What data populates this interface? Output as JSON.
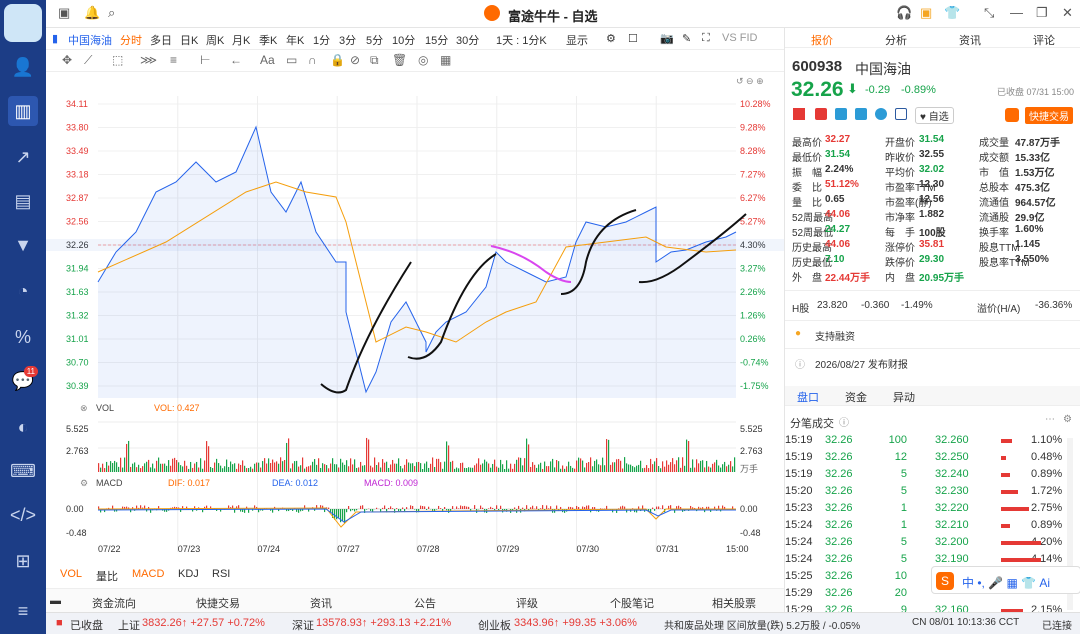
{
  "app": {
    "title": "富途牛牛 - 自选"
  },
  "sidebar": {
    "chat_badge": "11"
  },
  "toolbar": {
    "stock": "中国海油",
    "periods": [
      "分时",
      "多日",
      "日K",
      "周K",
      "月K",
      "季K",
      "年K",
      "1分",
      "3分",
      "5分",
      "10分",
      "15分",
      "30分"
    ],
    "active_period": "分时",
    "range": "1天 : 1分K",
    "display": "显示",
    "vs": "VS FID"
  },
  "chart_labels": {
    "vol": "VOL",
    "vol_value": "VOL: 0.427",
    "vol_unit": "万手",
    "macd": "MACD",
    "dif": "DIF: 0.017",
    "dea": "DEA: 0.012",
    "macd_value": "MACD: 0.009"
  },
  "chart_data": {
    "type": "line",
    "y_left": [
      "34.11",
      "33.80",
      "33.49",
      "33.18",
      "32.87",
      "32.56",
      "32.26",
      "31.94",
      "31.63",
      "31.32",
      "31.01",
      "30.70",
      "30.39"
    ],
    "y_right": [
      "10.28%",
      "9.28%",
      "8.28%",
      "7.27%",
      "6.27%",
      "5.27%",
      "4.30%",
      "3.27%",
      "2.26%",
      "1.26%",
      "0.26%",
      "-0.74%",
      "-1.75%"
    ],
    "vol_axis": [
      "5.525",
      "2.763"
    ],
    "macd_axis": [
      "0.00",
      "-0.48"
    ],
    "x": [
      "07/22",
      "07/23",
      "07/24",
      "07/27",
      "07/28",
      "07/29",
      "07/30",
      "07/31",
      "15:00"
    ]
  },
  "bottom_tabs": [
    "VOL",
    "量比",
    "MACD",
    "KDJ",
    "RSI"
  ],
  "info_tabs": [
    "资金流向",
    "快捷交易",
    "资讯",
    "公告",
    "评级",
    "个股笔记",
    "相关股票"
  ],
  "right": {
    "tabs": [
      "报价",
      "分析",
      "资讯",
      "评论"
    ],
    "code": "600938",
    "name": "中国海油",
    "price": "32.26",
    "change": "-0.29",
    "pct": "-0.89%",
    "status": "已收盘 07/31 15:00",
    "watch": "自选",
    "trade": "快捷交易",
    "stats": [
      [
        "最高价",
        "32.27",
        "开盘价",
        "31.54",
        "成交量",
        "47.87万手"
      ],
      [
        "最低价",
        "31.54",
        "昨收价",
        "32.55",
        "成交额",
        "15.33亿"
      ],
      [
        "振　幅",
        "2.24%",
        "平均价",
        "32.02",
        "市　值",
        "1.53万亿"
      ],
      [
        "委　比",
        "51.12%",
        "市盈率TTM",
        "12.30",
        "总股本",
        "475.3亿"
      ],
      [
        "量　比",
        "0.65",
        "市盈率(静)",
        "12.56",
        "流通值",
        "964.57亿"
      ],
      [
        "52周最高",
        "44.06",
        "市净率",
        "1.882",
        "流通股",
        "29.9亿"
      ],
      [
        "52周最低",
        "24.27",
        "每　手",
        "100股",
        "换手率",
        "1.60%"
      ],
      [
        "历史最高",
        "44.06",
        "涨停价",
        "35.81",
        "股息TTM",
        "1.145"
      ],
      [
        "历史最低",
        "7.10",
        "跌停价",
        "29.30",
        "股息率TTM",
        "3.550%"
      ],
      [
        "外　盘",
        "22.44万手",
        "内　盘",
        "20.95万手",
        "",
        ""
      ]
    ],
    "h_label": "H股",
    "h_price": "23.820",
    "h_change": "-0.360",
    "h_pct": "-1.49%",
    "premium_label": "溢价(H/A)",
    "premium": "-36.36%",
    "margin": "支持融资",
    "report": "2026/08/27  发布财报",
    "sub_tabs": [
      "盘口",
      "资金",
      "异动"
    ],
    "ticks_title": "分笔成交",
    "ticks": [
      [
        "15:19",
        "32.26",
        "100",
        "32.260",
        "1.10%"
      ],
      [
        "15:19",
        "32.26",
        "12",
        "32.250",
        "0.48%"
      ],
      [
        "15:19",
        "32.26",
        "5",
        "32.240",
        "0.89%"
      ],
      [
        "15:20",
        "32.26",
        "5",
        "32.230",
        "1.72%"
      ],
      [
        "15:23",
        "32.26",
        "1",
        "32.220",
        "2.75%"
      ],
      [
        "15:24",
        "32.26",
        "1",
        "32.210",
        "0.89%"
      ],
      [
        "15:24",
        "32.26",
        "5",
        "32.200",
        "4.20%"
      ],
      [
        "15:24",
        "32.26",
        "5",
        "32.190",
        "4.14%"
      ],
      [
        "15:25",
        "32.26",
        "10",
        "",
        ""
      ],
      [
        "15:29",
        "32.26",
        "20",
        "",
        ""
      ],
      [
        "15:29",
        "32.26",
        "9",
        "32.160",
        "2.15%"
      ]
    ]
  },
  "ticker": [
    [
      "已收盘",
      ""
    ],
    [
      "上证",
      "3832.26↑ +27.57 +0.72%"
    ],
    [
      "深证",
      "13578.93↑ +293.13 +2.21%"
    ],
    [
      "创业板",
      "3343.96↑ +99.35 +3.06%"
    ]
  ],
  "ticker_extra": {
    "news": "共和废品处理  区间放量(跌) 5.2万股 / -0.05%",
    "clock": "CN 08/01 10:13:36 CCT",
    "conn": "已连接"
  }
}
